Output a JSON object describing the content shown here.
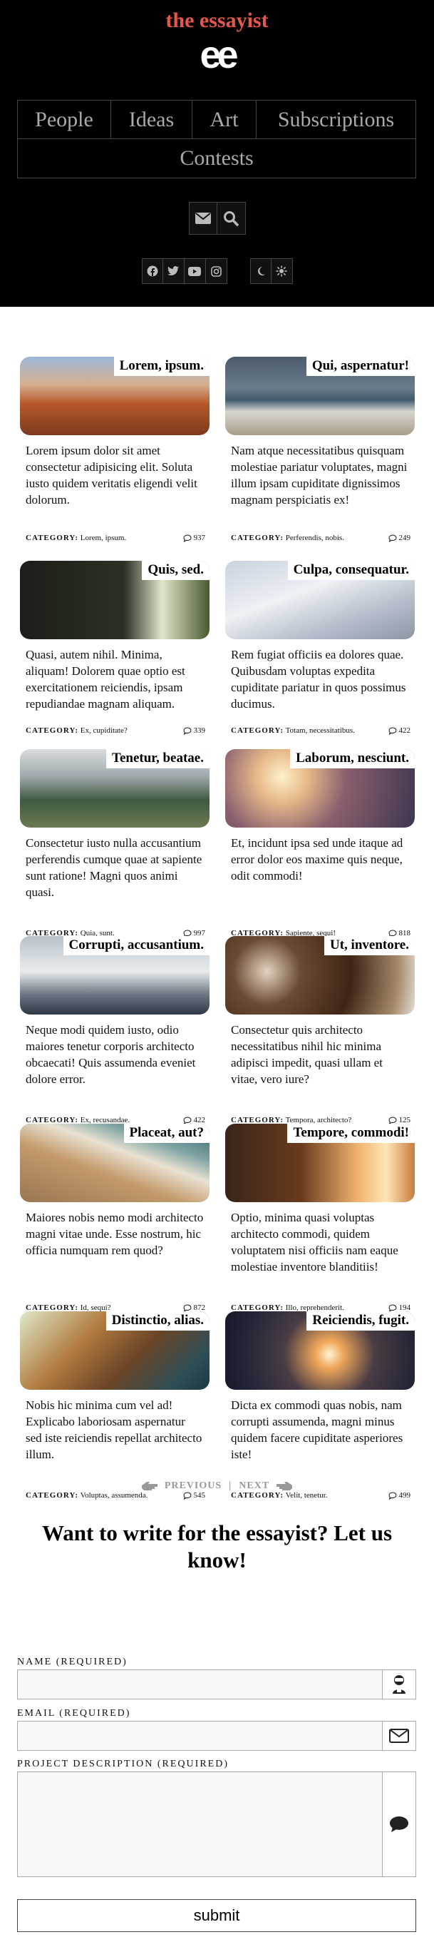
{
  "header": {
    "title": "the essayist",
    "logo": "ee",
    "nav": [
      [
        "People",
        "Ideas",
        "Art",
        "Subscriptions"
      ],
      [
        "Contests"
      ]
    ],
    "action_icons": [
      "envelope-icon",
      "search-icon"
    ],
    "social_icons": [
      "facebook-icon",
      "twitter-icon",
      "youtube-icon",
      "instagram-icon"
    ],
    "theme_icons": [
      "moon-icon",
      "sun-icon"
    ]
  },
  "cards": [
    {
      "title": "Lorem, ipsum.",
      "text": "Lorem ipsum dolor sit amet consectetur adipisicing elit. Soluta iusto quidem veritatis eligendi velit dolorum.",
      "category_label": "CATEGORY:",
      "category": "Lorem, ipsum.",
      "comments": "937"
    },
    {
      "title": "Qui, aspernatur!",
      "text": "Nam atque necessitatibus quisquam molestiae pariatur voluptates, magni illum ipsam cupiditate dignissimos magnam perspiciatis ex!",
      "category_label": "CATEGORY:",
      "category": "Perferendis, nobis.",
      "comments": "249"
    },
    {
      "title": "Quis, sed.",
      "text": "Quasi, autem nihil. Minima, aliquam! Dolorem quae optio est exercitationem reiciendis, ipsam repudiandae magnam aliquam.",
      "category_label": "CATEGORY:",
      "category": "Ex, cupiditate?",
      "comments": "339"
    },
    {
      "title": "Culpa, consequatur.",
      "text": "Rem fugiat officiis ea dolores quae. Quibusdam voluptas expedita cupiditate pariatur in quos possimus ducimus.",
      "category_label": "CATEGORY:",
      "category": "Totam, necessitatibus.",
      "comments": "422"
    },
    {
      "title": "Tenetur, beatae.",
      "text": "Consectetur iusto nulla accusantium perferendis cumque quae at sapiente sunt ratione! Magni quos animi quasi.",
      "category_label": "CATEGORY:",
      "category": "Quia, sunt.",
      "comments": "997"
    },
    {
      "title": "Laborum, nesciunt.",
      "text": "Et, incidunt ipsa sed unde itaque ad error dolor eos maxime quis neque, odit commodi!",
      "category_label": "CATEGORY:",
      "category": "Sapiente, sequi!",
      "comments": "818"
    },
    {
      "title": "Corrupti, accusantium.",
      "text": "Neque modi quidem iusto, odio maiores tenetur corporis architecto obcaecati! Quis assumenda eveniet dolore error.",
      "category_label": "CATEGORY:",
      "category": "Ex, recusandae.",
      "comments": "422"
    },
    {
      "title": "Ut, inventore.",
      "text": "Consectetur quis architecto necessitatibus nihil hic minima adipisci impedit, quasi ullam et vitae, vero iure?",
      "category_label": "CATEGORY:",
      "category": "Tempora, architecto?",
      "comments": "125"
    },
    {
      "title": "Placeat, aut?",
      "text": "Maiores nobis nemo modi architecto magni vitae unde. Esse nostrum, hic officia numquam rem quod?",
      "category_label": "CATEGORY:",
      "category": "Id, sequi?",
      "comments": "872"
    },
    {
      "title": "Tempore, commodi!",
      "text": "Optio, minima quasi voluptas architecto commodi, quidem voluptatem nisi officiis nam eaque molestiae inventore blanditiis!",
      "category_label": "CATEGORY:",
      "category": "Illo, reprehenderit.",
      "comments": "194"
    },
    {
      "title": "Distinctio, alias.",
      "text": "Nobis hic minima cum vel ad! Explicabo laboriosam aspernatur sed iste reiciendis repellat architecto illum.",
      "category_label": "CATEGORY:",
      "category": "Voluptas, assumenda.",
      "comments": "545"
    },
    {
      "title": "Reiciendis, fugit.",
      "text": "Dicta ex commodi quas nobis, nam corrupti assumenda, magni minus quidem facere cupiditate asperiores iste!",
      "category_label": "CATEGORY:",
      "category": "Velit, tenetur.",
      "comments": "499"
    }
  ],
  "pager": {
    "previous": "PREVIOUS",
    "separator": "|",
    "next": "NEXT"
  },
  "form": {
    "heading": "Want to write for the essayist? Let us know!",
    "name_label": "NAME (REQUIRED)",
    "email_label": "EMAIL (REQUIRED)",
    "project_label": "PROJECT DESCRIPTION (REQUIRED)",
    "submit": "submit"
  },
  "colors": {
    "brand": "#e4574a",
    "header_bg": "#000000"
  }
}
